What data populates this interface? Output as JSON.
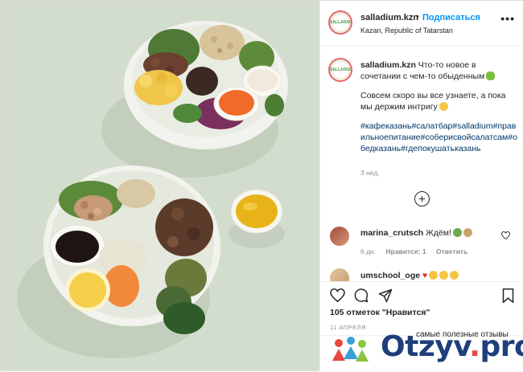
{
  "post": {
    "username": "salladium.kzn",
    "follow_label": "Подписаться",
    "separator": "•",
    "location": "Kazan, Republic of Tatarstan",
    "more_label": "•••",
    "logo_text": "SALLADIUM"
  },
  "caption": {
    "username": "salladium.kzn",
    "line1": "Что-то новое в сочетании с чем-то обыденным",
    "line2": "Совсем скоро вы все узнаете, а пока мы держим интригу",
    "hashtags": "#кафеказань#салатбар#salladium#правильноепитание#соберисвойсалатсам#обедказань#гдепокушатьказань",
    "time": "3 нед."
  },
  "comments": [
    {
      "username": "marina_crutsch",
      "text": "Ждём!",
      "time": "6 дн.",
      "likes": "Нравится: 1",
      "reply": "Ответить"
    },
    {
      "username": "umschool_oge",
      "text": "♥"
    }
  ],
  "actions": {
    "likes": "105 отметок \"Нравится\"",
    "date": "11 АПРЕЛЯ"
  },
  "watermark": {
    "tagline": "самые полезные отзывы",
    "brand_main": "Otzyv",
    "brand_dot": ".",
    "brand_tld": "pro"
  },
  "colors": {
    "follow_blue": "#0095f6",
    "hashtag_blue": "#00376b",
    "photo_bg": "#d5dfcf",
    "brand_navy": "#1e3f7a",
    "brand_red": "#e8473f"
  }
}
